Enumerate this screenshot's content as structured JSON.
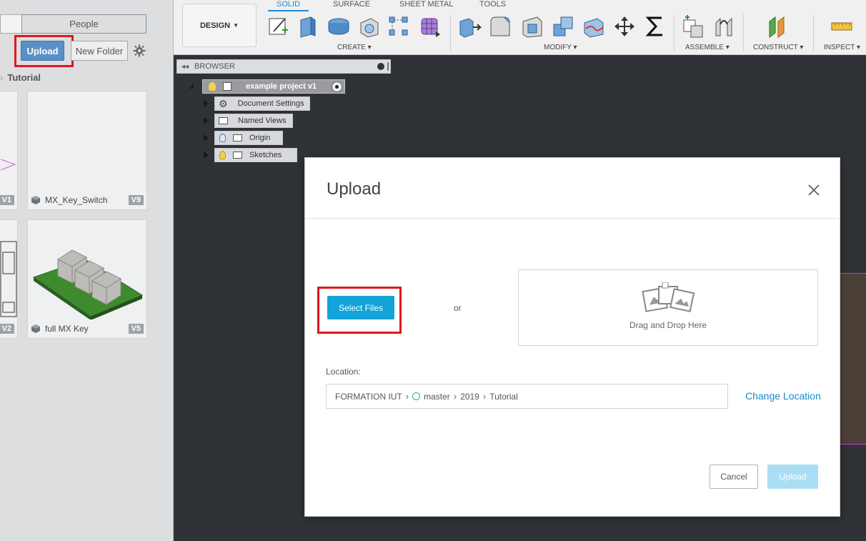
{
  "left_panel": {
    "tab_people": "People",
    "upload_label": "Upload",
    "new_folder_label": "New Folder",
    "breadcrumb": "Tutorial",
    "cards": [
      {
        "name": "",
        "version": "V1"
      },
      {
        "name": "MX_Key_Switch",
        "version": "V9"
      },
      {
        "name": "",
        "version": "V2"
      },
      {
        "name": "full MX Key",
        "version": "V5"
      }
    ]
  },
  "toolbar": {
    "workspace": "DESIGN",
    "tabs": [
      "SOLID",
      "SURFACE",
      "SHEET METAL",
      "TOOLS"
    ],
    "active_tab": "SOLID",
    "groups": [
      "CREATE ▾",
      "MODIFY ▾",
      "ASSEMBLE ▾",
      "CONSTRUCT ▾",
      "INSPECT ▾"
    ]
  },
  "browser": {
    "title": "BROWSER",
    "root": "example project v1",
    "items": [
      "Document Settings",
      "Named Views",
      "Origin",
      "Sketches"
    ]
  },
  "dialog": {
    "title": "Upload",
    "select_files": "Select Files",
    "or": "or",
    "drop_text": "Drag and Drop Here",
    "location_label": "Location:",
    "location_path": [
      "FORMATION IUT",
      "master",
      "2019",
      "Tutorial"
    ],
    "change_location": "Change Location",
    "cancel": "Cancel",
    "upload": "Upload"
  },
  "colors": {
    "accent": "#12a3d8",
    "highlight": "#e0161d",
    "upload_button": "#5b8fc6",
    "disabled_upload": "#a9def4"
  }
}
